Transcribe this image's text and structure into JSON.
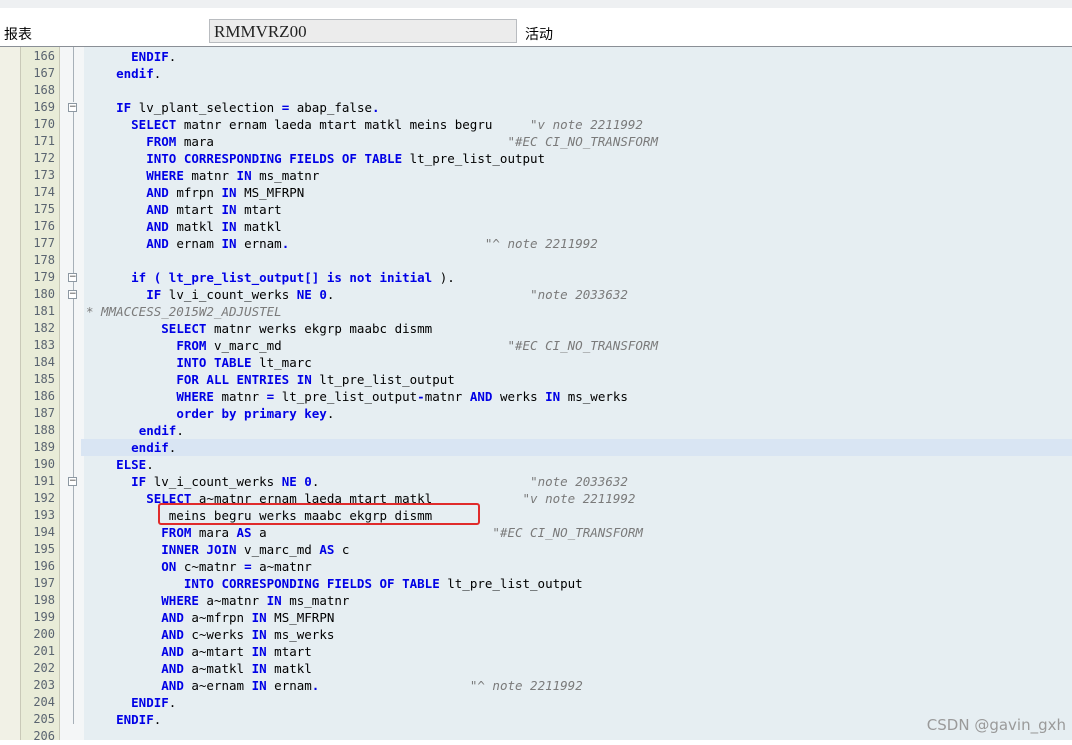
{
  "header": {
    "report_label": "报表",
    "program_name": "RMMVRZ00",
    "status": "活动"
  },
  "lines": [
    {
      "n": "166",
      "hl": false,
      "seg": [
        [
          "      ",
          ""
        ],
        [
          "ENDIF",
          "kw"
        ],
        [
          ".",
          ""
        ]
      ]
    },
    {
      "n": "167",
      "hl": false,
      "seg": [
        [
          "    ",
          ""
        ],
        [
          "endif",
          "kw"
        ],
        [
          ".",
          ""
        ]
      ]
    },
    {
      "n": "168",
      "hl": false,
      "seg": []
    },
    {
      "n": "169",
      "hl": false,
      "seg": [
        [
          "    ",
          ""
        ],
        [
          "IF",
          "kw"
        ],
        [
          " lv_plant_selection ",
          ""
        ],
        [
          "=",
          "kw"
        ],
        [
          " abap_false",
          ""
        ],
        [
          ".",
          "kw"
        ]
      ]
    },
    {
      "n": "170",
      "hl": false,
      "seg": [
        [
          "      ",
          ""
        ],
        [
          "SELECT",
          "kw"
        ],
        [
          " matnr ernam laeda mtart matkl meins begru     ",
          ""
        ],
        [
          "\"v note 2211992",
          "cm"
        ]
      ]
    },
    {
      "n": "171",
      "hl": false,
      "seg": [
        [
          "        ",
          ""
        ],
        [
          "FROM",
          "kw"
        ],
        [
          " mara                                       ",
          ""
        ],
        [
          "\"#EC CI_NO_TRANSFORM",
          "cm"
        ]
      ]
    },
    {
      "n": "172",
      "hl": false,
      "seg": [
        [
          "        ",
          ""
        ],
        [
          "INTO CORRESPONDING FIELDS OF TABLE",
          "kw"
        ],
        [
          " lt_pre_list_output",
          ""
        ]
      ]
    },
    {
      "n": "173",
      "hl": false,
      "seg": [
        [
          "        ",
          ""
        ],
        [
          "WHERE",
          "kw"
        ],
        [
          " matnr ",
          ""
        ],
        [
          "IN",
          "kw"
        ],
        [
          " ms_matnr",
          ""
        ]
      ]
    },
    {
      "n": "174",
      "hl": false,
      "seg": [
        [
          "        ",
          ""
        ],
        [
          "AND",
          "kw"
        ],
        [
          " mfrpn ",
          ""
        ],
        [
          "IN",
          "kw"
        ],
        [
          " MS_MFRPN",
          ""
        ]
      ]
    },
    {
      "n": "175",
      "hl": false,
      "seg": [
        [
          "        ",
          ""
        ],
        [
          "AND",
          "kw"
        ],
        [
          " mtart ",
          ""
        ],
        [
          "IN",
          "kw"
        ],
        [
          " mtart",
          ""
        ]
      ]
    },
    {
      "n": "176",
      "hl": false,
      "seg": [
        [
          "        ",
          ""
        ],
        [
          "AND",
          "kw"
        ],
        [
          " matkl ",
          ""
        ],
        [
          "IN",
          "kw"
        ],
        [
          " matkl",
          ""
        ]
      ]
    },
    {
      "n": "177",
      "hl": false,
      "seg": [
        [
          "        ",
          ""
        ],
        [
          "AND",
          "kw"
        ],
        [
          " ernam ",
          ""
        ],
        [
          "IN",
          "kw"
        ],
        [
          " ernam",
          ""
        ],
        [
          ".",
          "kw"
        ],
        [
          "                          ",
          ""
        ],
        [
          "\"^ note 2211992",
          "cm"
        ]
      ]
    },
    {
      "n": "178",
      "hl": false,
      "seg": []
    },
    {
      "n": "179",
      "hl": false,
      "seg": [
        [
          "      ",
          ""
        ],
        [
          "if ( lt_pre_list_output[] ",
          "kw"
        ],
        [
          "is not initial",
          "kw"
        ],
        [
          " ).",
          ""
        ]
      ]
    },
    {
      "n": "180",
      "hl": false,
      "seg": [
        [
          "        ",
          ""
        ],
        [
          "IF",
          "kw"
        ],
        [
          " lv_i_count_werks ",
          ""
        ],
        [
          "NE",
          "kw"
        ],
        [
          " ",
          ""
        ],
        [
          "0",
          "kw"
        ],
        [
          ".                          ",
          ""
        ],
        [
          "\"note 2033632",
          "cm"
        ]
      ]
    },
    {
      "n": "181",
      "hl": false,
      "seg": [
        [
          "* MMACCESS_2015W2_ADJUSTEL",
          "cm"
        ]
      ]
    },
    {
      "n": "182",
      "hl": false,
      "seg": [
        [
          "          ",
          ""
        ],
        [
          "SELECT",
          "kw"
        ],
        [
          " matnr werks ekgrp maabc dismm",
          ""
        ]
      ]
    },
    {
      "n": "183",
      "hl": false,
      "seg": [
        [
          "            ",
          ""
        ],
        [
          "FROM",
          "kw"
        ],
        [
          " v_marc_md                              ",
          ""
        ],
        [
          "\"#EC CI_NO_TRANSFORM",
          "cm"
        ]
      ]
    },
    {
      "n": "184",
      "hl": false,
      "seg": [
        [
          "            ",
          ""
        ],
        [
          "INTO TABLE",
          "kw"
        ],
        [
          " lt_marc",
          ""
        ]
      ]
    },
    {
      "n": "185",
      "hl": false,
      "seg": [
        [
          "            ",
          ""
        ],
        [
          "FOR ALL ENTRIES IN",
          "kw"
        ],
        [
          " lt_pre_list_output",
          ""
        ]
      ]
    },
    {
      "n": "186",
      "hl": false,
      "seg": [
        [
          "            ",
          ""
        ],
        [
          "WHERE",
          "kw"
        ],
        [
          " matnr ",
          ""
        ],
        [
          "=",
          "kw"
        ],
        [
          " lt_pre_list_output",
          ""
        ],
        [
          "-",
          "kw"
        ],
        [
          "matnr ",
          ""
        ],
        [
          "AND",
          "kw"
        ],
        [
          " werks ",
          ""
        ],
        [
          "IN",
          "kw"
        ],
        [
          " ms_werks",
          ""
        ]
      ]
    },
    {
      "n": "187",
      "hl": false,
      "seg": [
        [
          "            ",
          ""
        ],
        [
          "order by primary key",
          "kw"
        ],
        [
          ".",
          ""
        ]
      ]
    },
    {
      "n": "188",
      "hl": false,
      "seg": [
        [
          "       ",
          ""
        ],
        [
          "endif",
          "kw"
        ],
        [
          ".",
          ""
        ]
      ]
    },
    {
      "n": "189",
      "hl": true,
      "seg": [
        [
          "      ",
          ""
        ],
        [
          "endif",
          "kw"
        ],
        [
          ".",
          ""
        ]
      ]
    },
    {
      "n": "190",
      "hl": false,
      "seg": [
        [
          "    ",
          ""
        ],
        [
          "ELSE",
          "kw"
        ],
        [
          ".",
          ""
        ]
      ]
    },
    {
      "n": "191",
      "hl": false,
      "seg": [
        [
          "      ",
          ""
        ],
        [
          "IF",
          "kw"
        ],
        [
          " lv_i_count_werks ",
          ""
        ],
        [
          "NE",
          "kw"
        ],
        [
          " ",
          ""
        ],
        [
          "0",
          "kw"
        ],
        [
          ".                            ",
          ""
        ],
        [
          "\"note 2033632",
          "cm"
        ]
      ]
    },
    {
      "n": "192",
      "hl": false,
      "seg": [
        [
          "        ",
          ""
        ],
        [
          "SELECT",
          "kw"
        ],
        [
          " a~matnr ernam laeda mtart matkl            ",
          ""
        ],
        [
          "\"v note 2211992",
          "cm"
        ]
      ]
    },
    {
      "n": "193",
      "hl": false,
      "seg": [
        [
          "           meins begru werks maabc ekgrp dismm",
          ""
        ]
      ]
    },
    {
      "n": "194",
      "hl": false,
      "seg": [
        [
          "          ",
          ""
        ],
        [
          "FROM",
          "kw"
        ],
        [
          " mara ",
          ""
        ],
        [
          "AS",
          "kw"
        ],
        [
          " a                              ",
          ""
        ],
        [
          "\"#EC CI_NO_TRANSFORM",
          "cm"
        ]
      ]
    },
    {
      "n": "195",
      "hl": false,
      "seg": [
        [
          "          ",
          ""
        ],
        [
          "INNER JOIN",
          "kw"
        ],
        [
          " v_marc_md ",
          ""
        ],
        [
          "AS",
          "kw"
        ],
        [
          " c",
          ""
        ]
      ]
    },
    {
      "n": "196",
      "hl": false,
      "seg": [
        [
          "          ",
          ""
        ],
        [
          "ON",
          "kw"
        ],
        [
          " c~matnr ",
          ""
        ],
        [
          "=",
          "kw"
        ],
        [
          " a~matnr",
          ""
        ]
      ]
    },
    {
      "n": "197",
      "hl": false,
      "seg": [
        [
          "             ",
          ""
        ],
        [
          "INTO CORRESPONDING FIELDS OF TABLE",
          "kw"
        ],
        [
          " lt_pre_list_output",
          ""
        ]
      ]
    },
    {
      "n": "198",
      "hl": false,
      "seg": [
        [
          "          ",
          ""
        ],
        [
          "WHERE",
          "kw"
        ],
        [
          " a~matnr ",
          ""
        ],
        [
          "IN",
          "kw"
        ],
        [
          " ms_matnr",
          ""
        ]
      ]
    },
    {
      "n": "199",
      "hl": false,
      "seg": [
        [
          "          ",
          ""
        ],
        [
          "AND",
          "kw"
        ],
        [
          " a~mfrpn ",
          ""
        ],
        [
          "IN",
          "kw"
        ],
        [
          " MS_MFRPN",
          ""
        ]
      ]
    },
    {
      "n": "200",
      "hl": false,
      "seg": [
        [
          "          ",
          ""
        ],
        [
          "AND",
          "kw"
        ],
        [
          " c~werks ",
          ""
        ],
        [
          "IN",
          "kw"
        ],
        [
          " ms_werks",
          ""
        ]
      ]
    },
    {
      "n": "201",
      "hl": false,
      "seg": [
        [
          "          ",
          ""
        ],
        [
          "AND",
          "kw"
        ],
        [
          " a~mtart ",
          ""
        ],
        [
          "IN",
          "kw"
        ],
        [
          " mtart",
          ""
        ]
      ]
    },
    {
      "n": "202",
      "hl": false,
      "seg": [
        [
          "          ",
          ""
        ],
        [
          "AND",
          "kw"
        ],
        [
          " a~matkl ",
          ""
        ],
        [
          "IN",
          "kw"
        ],
        [
          " matkl",
          ""
        ]
      ]
    },
    {
      "n": "203",
      "hl": false,
      "seg": [
        [
          "          ",
          ""
        ],
        [
          "AND",
          "kw"
        ],
        [
          " a~ernam ",
          ""
        ],
        [
          "IN",
          "kw"
        ],
        [
          " ernam",
          ""
        ],
        [
          ".",
          "kw"
        ],
        [
          "                    ",
          ""
        ],
        [
          "\"^ note 2211992",
          "cm"
        ]
      ]
    },
    {
      "n": "204",
      "hl": false,
      "seg": [
        [
          "      ",
          ""
        ],
        [
          "ENDIF",
          "kw"
        ],
        [
          ".",
          ""
        ]
      ]
    },
    {
      "n": "205",
      "hl": false,
      "seg": [
        [
          "    ",
          ""
        ],
        [
          "ENDIF",
          "kw"
        ],
        [
          ".",
          ""
        ]
      ]
    },
    {
      "n": "206",
      "hl": false,
      "seg": []
    }
  ],
  "watermark": "CSDN @gavin_gxh"
}
